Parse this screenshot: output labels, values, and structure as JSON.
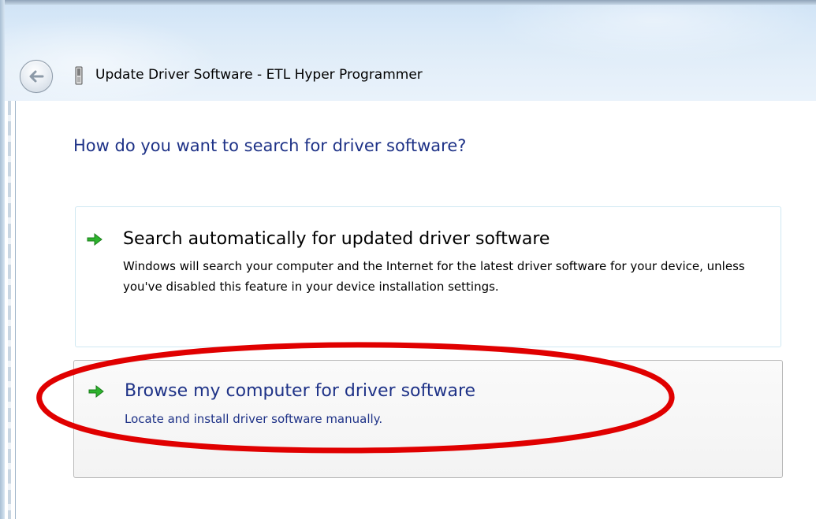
{
  "window": {
    "title": "Update Driver Software - ETL Hyper Programmer"
  },
  "icons": {
    "back": "back-arrow-icon",
    "device": "device-icon",
    "option_arrow": "green-arrow-icon"
  },
  "main": {
    "instruction": "How do you want to search for driver software?",
    "options": [
      {
        "title": "Search automatically for updated driver software",
        "description": "Windows will search your computer and the Internet for the latest driver software for your device, unless you've disabled this feature in your device installation settings."
      },
      {
        "title": "Browse my computer for driver software",
        "description": "Locate and install driver software manually."
      }
    ]
  },
  "colors": {
    "heading_blue": "#1e3287",
    "arrow_green": "#2db32d",
    "highlight_red": "#e00000"
  }
}
